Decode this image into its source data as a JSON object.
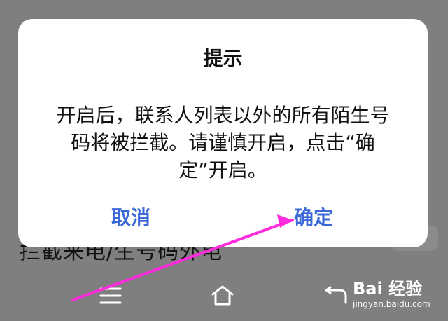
{
  "background": {
    "partial_text": "拦截来电/生号码外电"
  },
  "dialog": {
    "title": "提示",
    "message": "开启后，联系人列表以外的所有陌生号\n码将被拦截。请谨慎开启，点击“确\n定”开启。",
    "cancel_label": "取消",
    "confirm_label": "确定"
  },
  "navigation": {
    "menu_icon": "menu-icon",
    "home_icon": "home-icon",
    "back_icon": "back-icon"
  },
  "annotation": {
    "arrow_color": "#ff2bdc",
    "target": "确定"
  },
  "watermark": {
    "line1": "Bai 经验",
    "line2": "jingyan.baidu.com"
  },
  "colors": {
    "overlay": "#7f7f7f",
    "dialog_bg": "#ffffff",
    "button_text": "#3b6ad8",
    "text": "#111111",
    "arrow": "#ff2bdc"
  }
}
